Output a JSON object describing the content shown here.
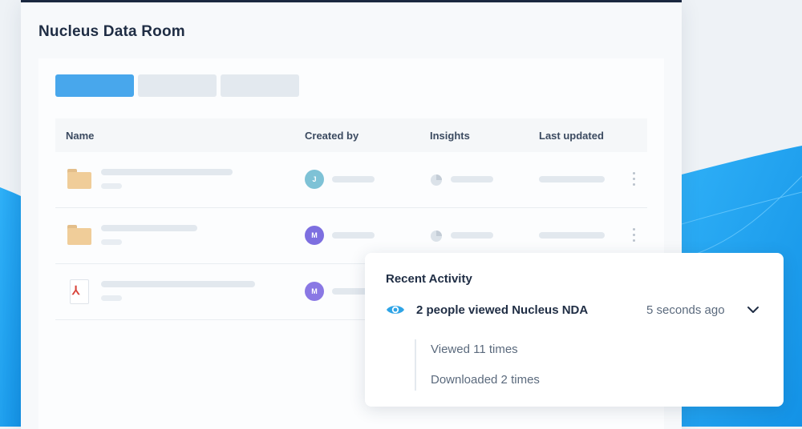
{
  "room": {
    "title": "Nucleus Data Room"
  },
  "table": {
    "headers": {
      "name": "Name",
      "created_by": "Created by",
      "insights": "Insights",
      "last_updated": "Last updated"
    },
    "rows": [
      {
        "type": "folder",
        "avatar_initial": "J",
        "avatar_color": "#7ec2d6"
      },
      {
        "type": "folder",
        "avatar_initial": "M",
        "avatar_color": "#7d6fe0"
      },
      {
        "type": "pdf",
        "avatar_initial": "M",
        "avatar_color": "#8a78e4"
      }
    ]
  },
  "recent_activity": {
    "title": "Recent Activity",
    "entry": {
      "icon": "eye-icon",
      "text": "2 people viewed Nucleus NDA",
      "time": "5 seconds ago"
    },
    "details": [
      "Viewed 11 times",
      "Downloaded 2 times"
    ]
  },
  "colors": {
    "accent": "#48a7ec",
    "background_wave": "#21a6f3",
    "title": "#1f2d44"
  }
}
